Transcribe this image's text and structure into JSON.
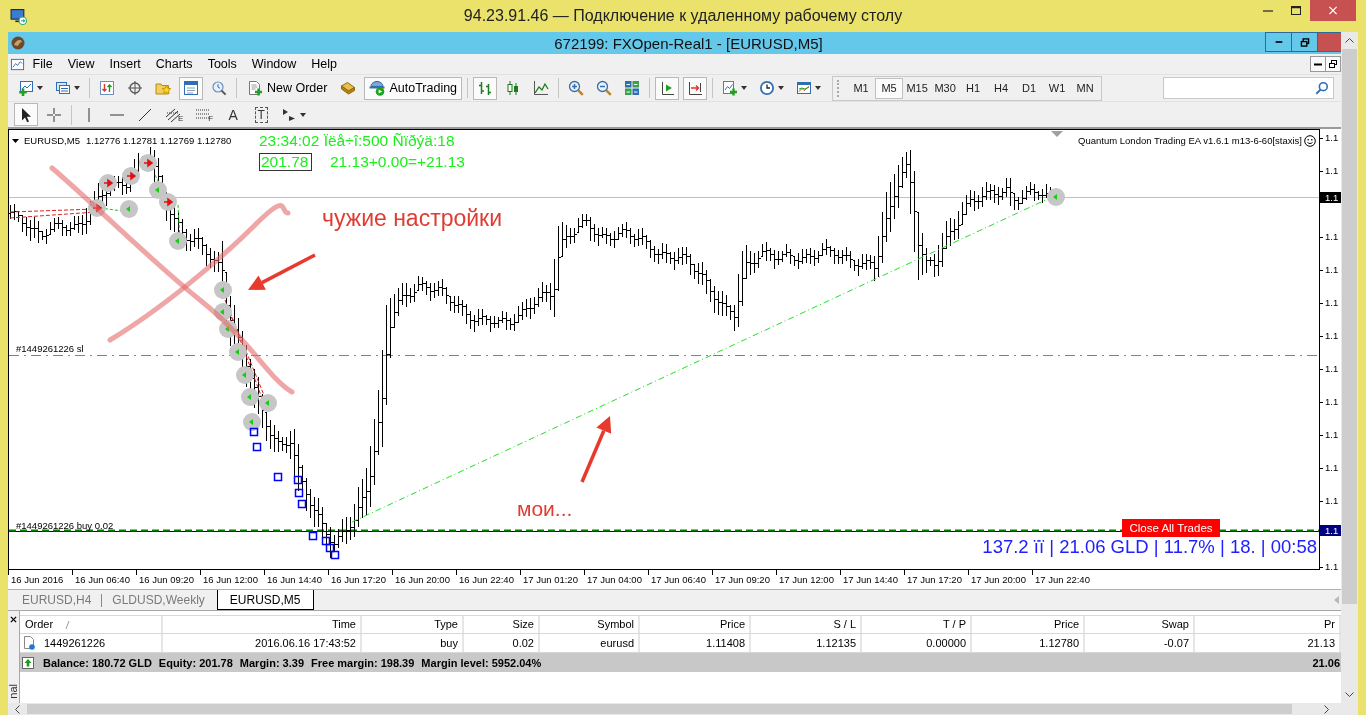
{
  "rdp_window": {
    "title": "94.23.91.46 — Подключение к удаленному рабочему столу"
  },
  "app_window": {
    "title": "672199: FXOpen-Real1 - [EURUSD,M5]"
  },
  "menu": [
    "File",
    "View",
    "Insert",
    "Charts",
    "Tools",
    "Window",
    "Help"
  ],
  "main_toolbar": [
    [
      {
        "kind": "new-chart",
        "on": false
      },
      {
        "kind": "profiles",
        "on": false
      }
    ],
    [
      {
        "kind": "market-watch",
        "on": false
      },
      {
        "kind": "data-window",
        "on": false
      },
      {
        "kind": "navigator",
        "on": false
      },
      {
        "kind": "terminal",
        "on": true
      },
      {
        "kind": "tester",
        "on": false
      }
    ],
    [
      {
        "kind": "new-order",
        "label": "New Order",
        "on": false
      },
      {
        "kind": "editor",
        "on": false
      },
      {
        "kind": "autotrading",
        "label": "AutoTrading",
        "on": true
      }
    ],
    [
      {
        "kind": "bar-chart",
        "on": true
      },
      {
        "kind": "candles",
        "on": false
      },
      {
        "kind": "line-chart",
        "on": false
      }
    ],
    [
      {
        "kind": "zoom-in",
        "on": false
      },
      {
        "kind": "zoom-out",
        "on": false
      },
      {
        "kind": "tile",
        "on": false
      }
    ],
    [
      {
        "kind": "chart-shift",
        "on": true
      },
      {
        "kind": "autoscroll",
        "on": true
      }
    ],
    [
      {
        "kind": "indicators",
        "on": false
      },
      {
        "kind": "periods",
        "on": false
      },
      {
        "kind": "templates",
        "on": false
      }
    ]
  ],
  "periods": [
    {
      "label": "M1",
      "selected": false
    },
    {
      "label": "M5",
      "selected": true
    },
    {
      "label": "M15",
      "selected": false
    },
    {
      "label": "M30",
      "selected": false
    },
    {
      "label": "H1",
      "selected": false
    },
    {
      "label": "H4",
      "selected": false
    },
    {
      "label": "D1",
      "selected": false
    },
    {
      "label": "W1",
      "selected": false
    },
    {
      "label": "MN",
      "selected": false
    }
  ],
  "drawing_tools": [
    [
      {
        "kind": "cursor",
        "selected": true
      },
      {
        "kind": "crosshair",
        "selected": false
      }
    ],
    [
      {
        "kind": "vertical-line",
        "selected": false
      },
      {
        "kind": "horizontal-line",
        "selected": false
      },
      {
        "kind": "trendline",
        "selected": false
      },
      {
        "kind": "fibo-channel",
        "glyph": "E",
        "selected": false
      },
      {
        "kind": "fibo",
        "glyph": "F",
        "selected": false
      },
      {
        "kind": "text",
        "glyph": "A",
        "selected": false
      },
      {
        "kind": "label",
        "glyph": "T",
        "selected": false
      },
      {
        "kind": "arrows",
        "selected": false
      }
    ]
  ],
  "chart": {
    "symbol": "EURUSD,M5",
    "prices": "1.12776 1.12781 1.12769 1.12780",
    "info_line": "23:34:02 Ïëå÷î:500 Ñïðýä:18",
    "equity": "201.78",
    "profit_formula": "21.13+0.00=+21.13",
    "expert_label": "Quantum London Trading EA v1.6.1 m13-6-60[staxis]",
    "annotations": [
      "чужие настройки",
      "мои..."
    ],
    "order_lines": [
      {
        "kind": "stop-loss",
        "label": "#1449261226 sl"
      },
      {
        "kind": "order",
        "label": "#1449261226 buy 0.02"
      }
    ],
    "close_button": "Close All Trades",
    "status_line": "137.2 ïï | 21.06 GLD | 11.7% | 18. | 00:58",
    "price_labels": [
      "1.1",
      "1.1",
      "1.1",
      "1.1",
      "1.1",
      "1.1",
      "1.1",
      "1.1",
      "1.1",
      "1.1",
      "1.1",
      "1.1"
    ],
    "bid_label": "1.1",
    "order_price_label": "1.1",
    "time_labels": [
      "16 Jun 2016",
      "16 Jun 06:40",
      "16 Jun 09:20",
      "16 Jun 12:00",
      "16 Jun 14:40",
      "16 Jun 17:20",
      "16 Jun 20:00",
      "16 Jun 22:40",
      "17 Jun 01:20",
      "17 Jun 04:00",
      "17 Jun 06:40",
      "17 Jun 09:20",
      "17 Jun 12:00",
      "17 Jun 14:40",
      "17 Jun 17:20",
      "17 Jun 20:00",
      "17 Jun 22:40"
    ]
  },
  "tabs": [
    {
      "label": "EURUSD,H4",
      "selected": false
    },
    {
      "label": "GLDUSD,Weekly",
      "selected": false
    },
    {
      "label": "EURUSD,M5",
      "selected": true
    }
  ],
  "terminal": {
    "side_label": "nal",
    "columns": [
      "Order",
      "Time",
      "Type",
      "Size",
      "Symbol",
      "Price",
      "S / L",
      "T / P",
      "Price",
      "Swap",
      "Pr"
    ],
    "rows": [
      {
        "cells": [
          "1449261226",
          "2016.06.16 17:43:52",
          "buy",
          "0.02",
          "eurusd",
          "1.11408",
          "1.12135",
          "0.00000",
          "1.12780",
          "-0.07",
          "21.13"
        ]
      }
    ],
    "summary": [
      "Balance: 180.72 GLD",
      "Equity: 201.78",
      "Margin: 3.39",
      "Free margin: 198.39",
      "Margin level: 5952.04%"
    ],
    "summary_total": "21.06"
  }
}
